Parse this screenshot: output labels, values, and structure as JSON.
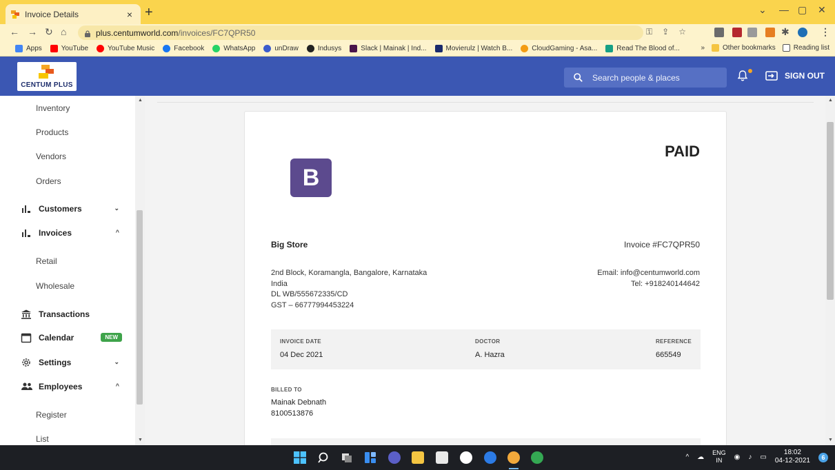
{
  "browser": {
    "tab_title": "Invoice Details",
    "tab_close": "×",
    "new_tab": "+",
    "url_host": "plus.centumworld.com",
    "url_path": "/invoices/FC7QPR50",
    "window_controls": [
      "⌄",
      "—",
      "▢",
      "✕"
    ],
    "bookmarks": [
      {
        "label": "Apps",
        "color": "#4285f4"
      },
      {
        "label": "YouTube",
        "color": "#ff0000"
      },
      {
        "label": "YouTube Music",
        "color": "#ff0000"
      },
      {
        "label": "Facebook",
        "color": "#1877f2"
      },
      {
        "label": "WhatsApp",
        "color": "#25d366"
      },
      {
        "label": "unDraw",
        "color": "#3b5ccc"
      },
      {
        "label": "Indusys",
        "color": "#222222"
      },
      {
        "label": "Slack | Mainak | Ind...",
        "color": "#4a154b"
      },
      {
        "label": "Movierulz | Watch B...",
        "color": "#1a2a6c"
      },
      {
        "label": "CloudGaming - Asa...",
        "color": "#f39c12"
      },
      {
        "label": "Read The Blood of...",
        "color": "#16a085"
      }
    ],
    "bookmarks_overflow": "»",
    "other_bookmarks": "Other bookmarks",
    "reading_list": "Reading list"
  },
  "header": {
    "logo_text": "CENTUM PLUS",
    "search_placeholder": "Search people & places",
    "signout_label": "SIGN OUT"
  },
  "sidebar": {
    "items": [
      {
        "label": "Inventory",
        "type": "sub"
      },
      {
        "label": "Products",
        "type": "sub"
      },
      {
        "label": "Vendors",
        "type": "sub"
      },
      {
        "label": "Orders",
        "type": "sub"
      },
      {
        "label": "Customers",
        "type": "main",
        "icon": "bar-chart-icon",
        "chevron": "⌄"
      },
      {
        "label": "Invoices",
        "type": "main",
        "icon": "bar-chart-icon",
        "chevron": "^"
      },
      {
        "label": "Retail",
        "type": "sub"
      },
      {
        "label": "Wholesale",
        "type": "sub"
      },
      {
        "label": "Transactions",
        "type": "main",
        "icon": "bank-icon"
      },
      {
        "label": "Calendar",
        "type": "main",
        "icon": "calendar-icon",
        "badge": "NEW"
      },
      {
        "label": "Settings",
        "type": "main",
        "icon": "gear-icon",
        "chevron": "⌄"
      },
      {
        "label": "Employees",
        "type": "main",
        "icon": "people-icon",
        "chevron": "^"
      },
      {
        "label": "Register",
        "type": "sub"
      },
      {
        "label": "List",
        "type": "sub"
      }
    ]
  },
  "invoice": {
    "status": "PAID",
    "logo_letter": "B",
    "store_name": "Big Store",
    "invoice_number": "Invoice #FC7QPR50",
    "address_lines": [
      "2nd Block, Koramangla, Bangalore, Karnataka",
      "India",
      "DL WB/555672335/CD",
      "GST – 66777994453224"
    ],
    "email": "Email: info@centumworld.com",
    "tel": "Tel: +918240144642",
    "meta": {
      "date_label": "INVOICE DATE",
      "date_value": "04 Dec 2021",
      "doctor_label": "DOCTOR",
      "doctor_value": "A. Hazra",
      "reference_label": "REFERENCE",
      "reference_value": "665549"
    },
    "billed_label": "BILLED TO",
    "billed_name": "Mainak Debnath",
    "billed_phone": "8100513876"
  },
  "taskbar": {
    "lang_top": "ENG",
    "lang_bottom": "IN",
    "time": "18:02",
    "date": "04-12-2021",
    "notifications": "6"
  }
}
